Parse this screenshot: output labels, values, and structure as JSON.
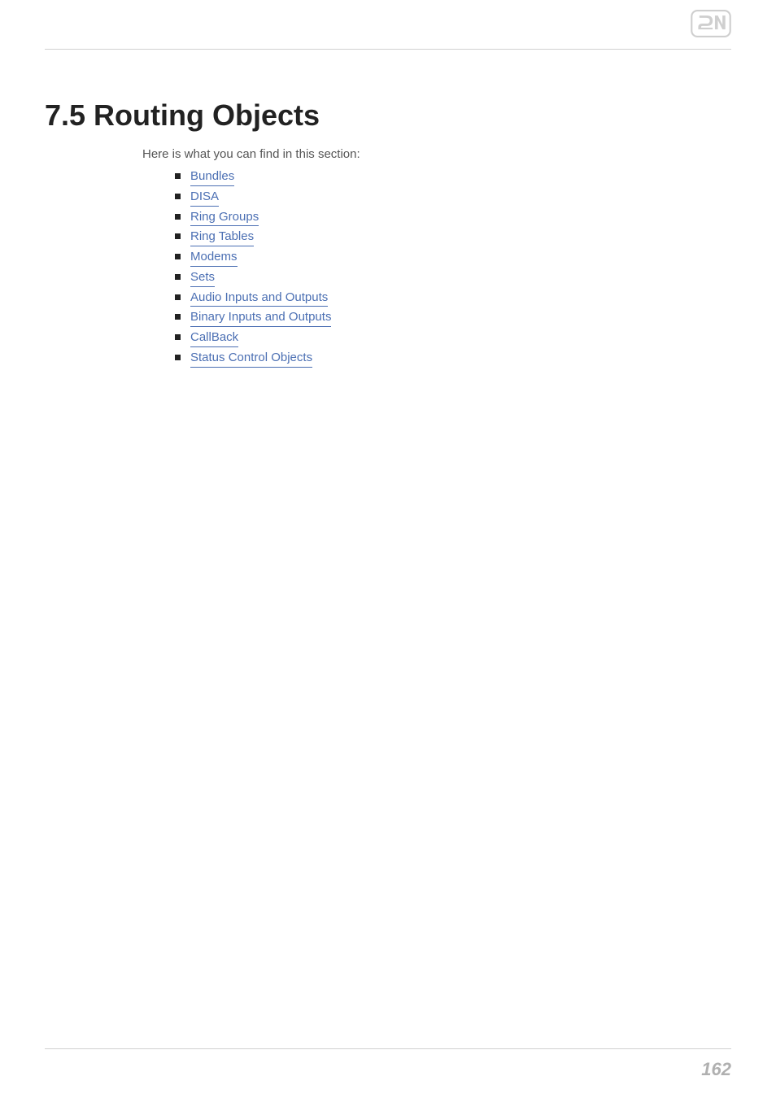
{
  "logo": {
    "alt": "2N"
  },
  "heading": "7.5 Routing Objects",
  "intro": "Here is what you can find in this section:",
  "links": [
    {
      "label": "Bundles"
    },
    {
      "label": "DISA"
    },
    {
      "label": "Ring Groups"
    },
    {
      "label": "Ring Tables"
    },
    {
      "label": "Modems"
    },
    {
      "label": "Sets"
    },
    {
      "label": "Audio Inputs and Outputs"
    },
    {
      "label": "Binary Inputs and Outputs"
    },
    {
      "label": "CallBack"
    },
    {
      "label": "Status Control Objects"
    }
  ],
  "page_number": "162"
}
